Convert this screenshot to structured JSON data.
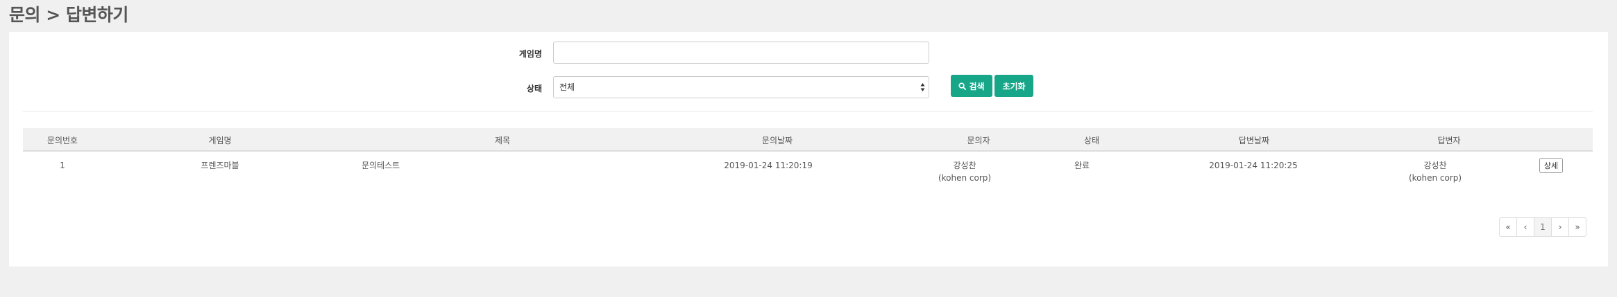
{
  "breadcrumb": {
    "title": "문의 > 답변하기"
  },
  "search_form": {
    "game_label": "게임명",
    "game_value": "",
    "status_label": "상태",
    "status_selected": "전체",
    "search_button": "검색",
    "reset_button": "초기화"
  },
  "table": {
    "headers": {
      "id": "문의번호",
      "game": "게임명",
      "title": "제목",
      "inquiry_date": "문의날짜",
      "inquirer": "문의자",
      "status": "상태",
      "answer_date": "답변날짜",
      "answerer": "답변자"
    },
    "rows": [
      {
        "id": "1",
        "game": "프렌즈마블",
        "title": "문의테스트",
        "inquiry_date": "2019-01-24 11:20:19",
        "inquirer_name": "강성찬",
        "inquirer_org": "(kohen corp)",
        "status": "완료",
        "answer_date": "2019-01-24 11:20:25",
        "answerer_name": "강성찬",
        "answerer_org": "(kohen corp)",
        "detail_button": "상세"
      }
    ]
  },
  "pagination": {
    "first": "«",
    "prev": "‹",
    "current": "1",
    "next": "›",
    "last": "»"
  },
  "colors": {
    "primary": "#18a689",
    "background": "#f0f0f0"
  },
  "icons": {
    "search": "search-icon"
  }
}
